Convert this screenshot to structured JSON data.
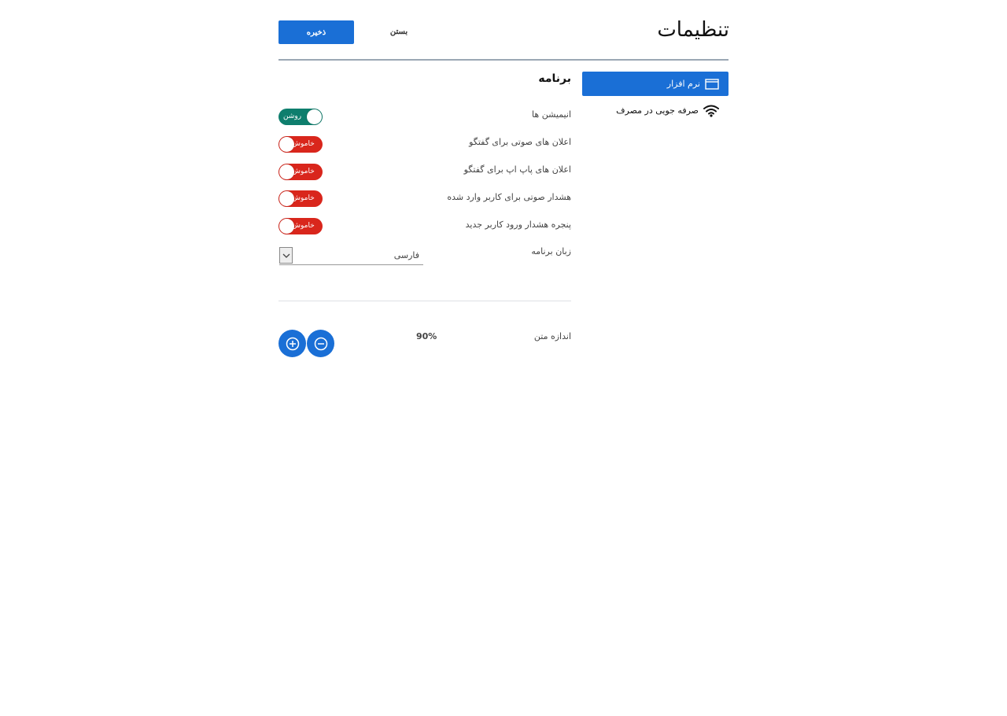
{
  "header": {
    "title": "تنظیمات",
    "save_label": "ذخیره",
    "close_label": "بستن"
  },
  "sidebar": {
    "items": [
      {
        "label": "نرم افزار",
        "icon": "window-icon",
        "active": true
      },
      {
        "label": "صرفه جویی در مصرف",
        "icon": "wifi-icon",
        "active": false
      }
    ]
  },
  "main": {
    "section_title": "برنامه",
    "toggles": [
      {
        "label": "انیمیشن ها",
        "state": "روشن",
        "on": true
      },
      {
        "label": "اعلان های صوتی برای گفتگو",
        "state": "خاموش",
        "on": false
      },
      {
        "label": "اعلان های پاپ اپ برای گفتگو",
        "state": "خاموش",
        "on": false
      },
      {
        "label": "هشدار صوتی برای کاربر وارد شده",
        "state": "خاموش",
        "on": false
      },
      {
        "label": "پنجره هشدار ورود کاربر جدید",
        "state": "خاموش",
        "on": false
      }
    ],
    "language": {
      "label": "زبان برنامه",
      "value": "فارسی"
    },
    "text_size": {
      "label": "اندازه متن",
      "value": "90%"
    }
  },
  "colors": {
    "accent": "#1a6fd6",
    "toggle_on": "#0e7e6d",
    "toggle_off": "#d9261c"
  }
}
